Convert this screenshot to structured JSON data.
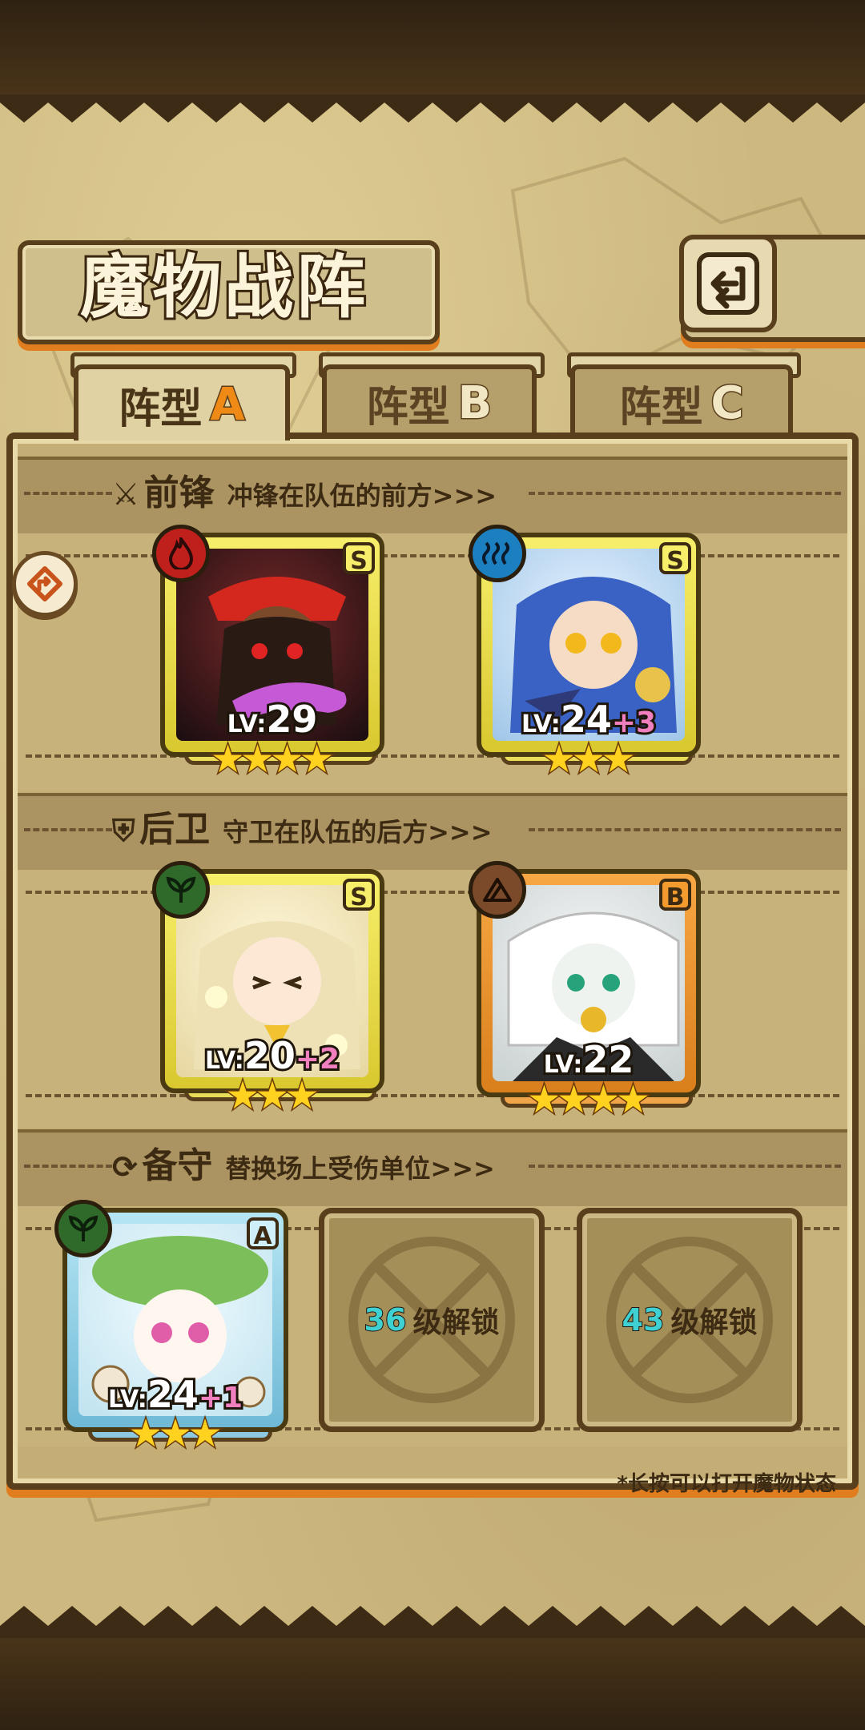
{
  "header": {
    "title": "魔物战阵",
    "back_icon": "return-icon"
  },
  "tabs": [
    {
      "label": "阵型",
      "letter": "A",
      "active": true
    },
    {
      "label": "阵型",
      "letter": "B",
      "active": false
    },
    {
      "label": "阵型",
      "letter": "C",
      "active": false
    }
  ],
  "sections": {
    "front": {
      "name": "前锋",
      "desc": "冲锋在队伍的前方>>>",
      "icon": "sword-icon"
    },
    "rear": {
      "name": "后卫",
      "desc": "守卫在队伍的后方>>>",
      "icon": "shield-icon"
    },
    "reserve": {
      "name": "备守",
      "desc": "替换场上受伤单位>>>",
      "icon": "swap-icon"
    }
  },
  "cards": [
    {
      "id": "front-1",
      "element": "fire",
      "rank": "S",
      "lv_prefix": "LV:",
      "level": "29",
      "bonus": "",
      "stars": 4,
      "frame": "gold"
    },
    {
      "id": "front-2",
      "element": "water",
      "rank": "S",
      "lv_prefix": "LV:",
      "level": "24",
      "bonus": "+3",
      "stars": 3,
      "frame": "gold"
    },
    {
      "id": "rear-1",
      "element": "wind",
      "rank": "S",
      "lv_prefix": "LV:",
      "level": "20",
      "bonus": "+2",
      "stars": 3,
      "frame": "gold"
    },
    {
      "id": "rear-2",
      "element": "earth",
      "rank": "B",
      "lv_prefix": "LV:",
      "level": "22",
      "bonus": "",
      "stars": 4,
      "frame": "orange"
    },
    {
      "id": "reserve-1",
      "element": "wind",
      "rank": "A",
      "lv_prefix": "LV:",
      "level": "24",
      "bonus": "+1",
      "stars": 3,
      "frame": "blue"
    }
  ],
  "locked_slots": [
    {
      "level": "36",
      "text": "级解锁"
    },
    {
      "level": "43",
      "text": "级解锁"
    }
  ],
  "hint": "*长按可以打开魔物状态",
  "colors": {
    "accent_orange": "#e07e1f",
    "frame_brown": "#5a3f1c",
    "parchment": "#cdb980"
  }
}
